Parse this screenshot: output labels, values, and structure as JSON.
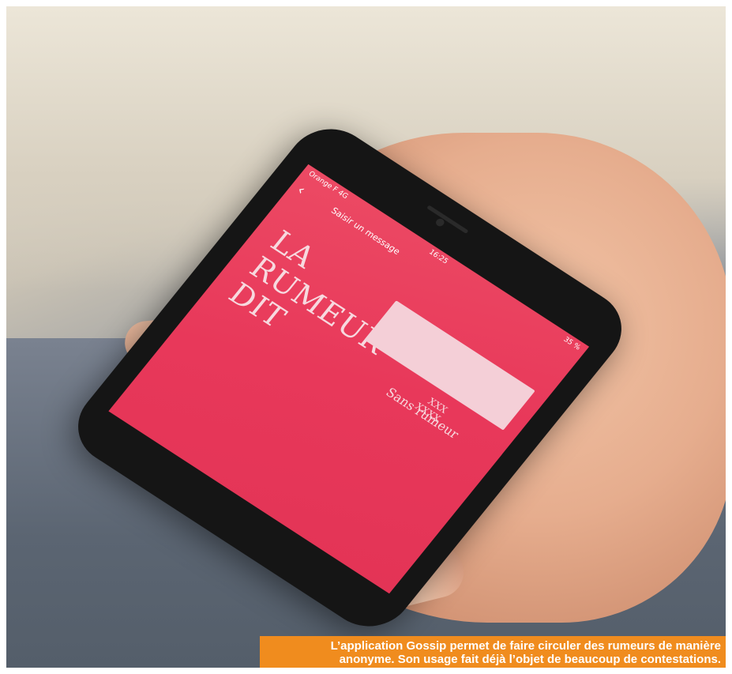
{
  "phone": {
    "status": {
      "carrier": "Orange F 4G",
      "time": "16:25",
      "battery": "35 %"
    },
    "nav": {
      "back_icon": "chevron-left-icon",
      "title": "Saisir un message"
    },
    "confirm_icon": "check-icon",
    "headline": [
      "LA",
      "RUMEUR",
      "DIT"
    ],
    "counter": "XXX",
    "sub_counter": "XXXX",
    "category": "Sans rumeur"
  },
  "caption": {
    "line1": "L’application Gossip permet de faire circuler des rumeurs de manière",
    "line2": "anonyme. Son usage fait déjà l’objet de beaucoup de contestations."
  },
  "colors": {
    "screen": "#e8385a",
    "caption_bg": "#f08c1e"
  }
}
